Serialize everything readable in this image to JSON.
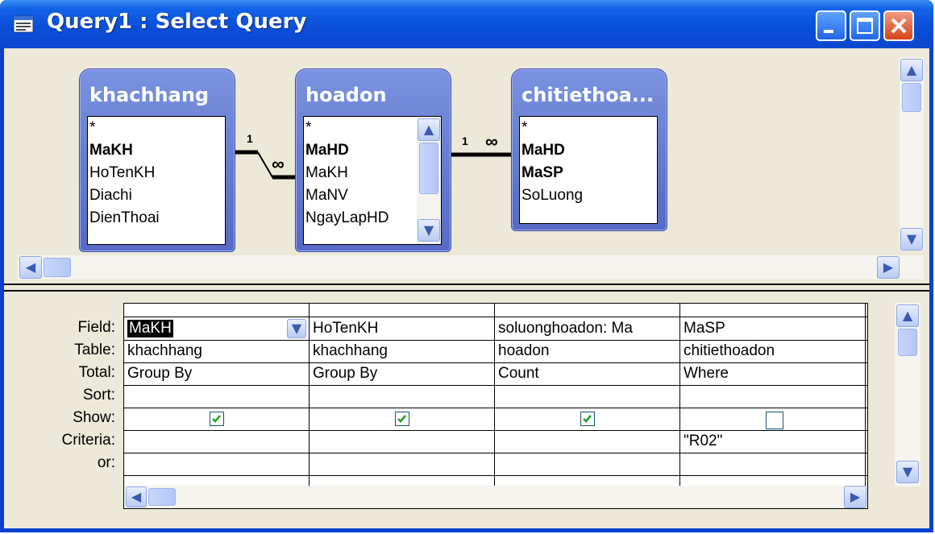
{
  "window": {
    "title": "Query1 : Select Query",
    "title_icon": "query-icon",
    "buttons": [
      "minimize-icon",
      "maximize-icon",
      "close-icon"
    ]
  },
  "tables": [
    {
      "name": "khachhang",
      "fields": [
        "*",
        "MaKH",
        "HoTenKH",
        "Diachi",
        "DienThoai"
      ],
      "bold_fields": [
        "MaKH"
      ]
    },
    {
      "name": "hoadon",
      "fields": [
        "*",
        "MaHD",
        "MaKH",
        "MaNV",
        "NgayLapHD"
      ],
      "bold_fields": [
        "MaHD"
      ]
    },
    {
      "name": "chitiethoa...",
      "fields": [
        "*",
        "MaHD",
        "MaSP",
        "SoLuong"
      ],
      "bold_fields": [
        "MaHD",
        "MaSP"
      ]
    }
  ],
  "relationships": [
    {
      "one": "1",
      "many": "∞"
    },
    {
      "one": "1",
      "many": "∞"
    }
  ],
  "grid": {
    "row_labels": [
      "Field:",
      "Table:",
      "Total:",
      "Sort:",
      "Show:",
      "Criteria:",
      "or:"
    ],
    "columns": [
      {
        "field": "MaKH",
        "table": "khachhang",
        "total": "Group By",
        "sort": "",
        "show": true,
        "criteria": "",
        "or": ""
      },
      {
        "field": "HoTenKH",
        "table": "khachhang",
        "total": "Group By",
        "sort": "",
        "show": true,
        "criteria": "",
        "or": ""
      },
      {
        "field": "soluonghoadon: Ma",
        "table": "hoadon",
        "total": "Count",
        "sort": "",
        "show": true,
        "criteria": "",
        "or": ""
      },
      {
        "field": "MaSP",
        "table": "chitiethoadon",
        "total": "Where",
        "sort": "",
        "show": false,
        "criteria": "\"R02\"",
        "or": ""
      }
    ]
  },
  "colors": {
    "titlebar": "#0a4fd8",
    "table_header": "#6c82d8",
    "face": "#ece9d8",
    "selection": "#000000"
  }
}
